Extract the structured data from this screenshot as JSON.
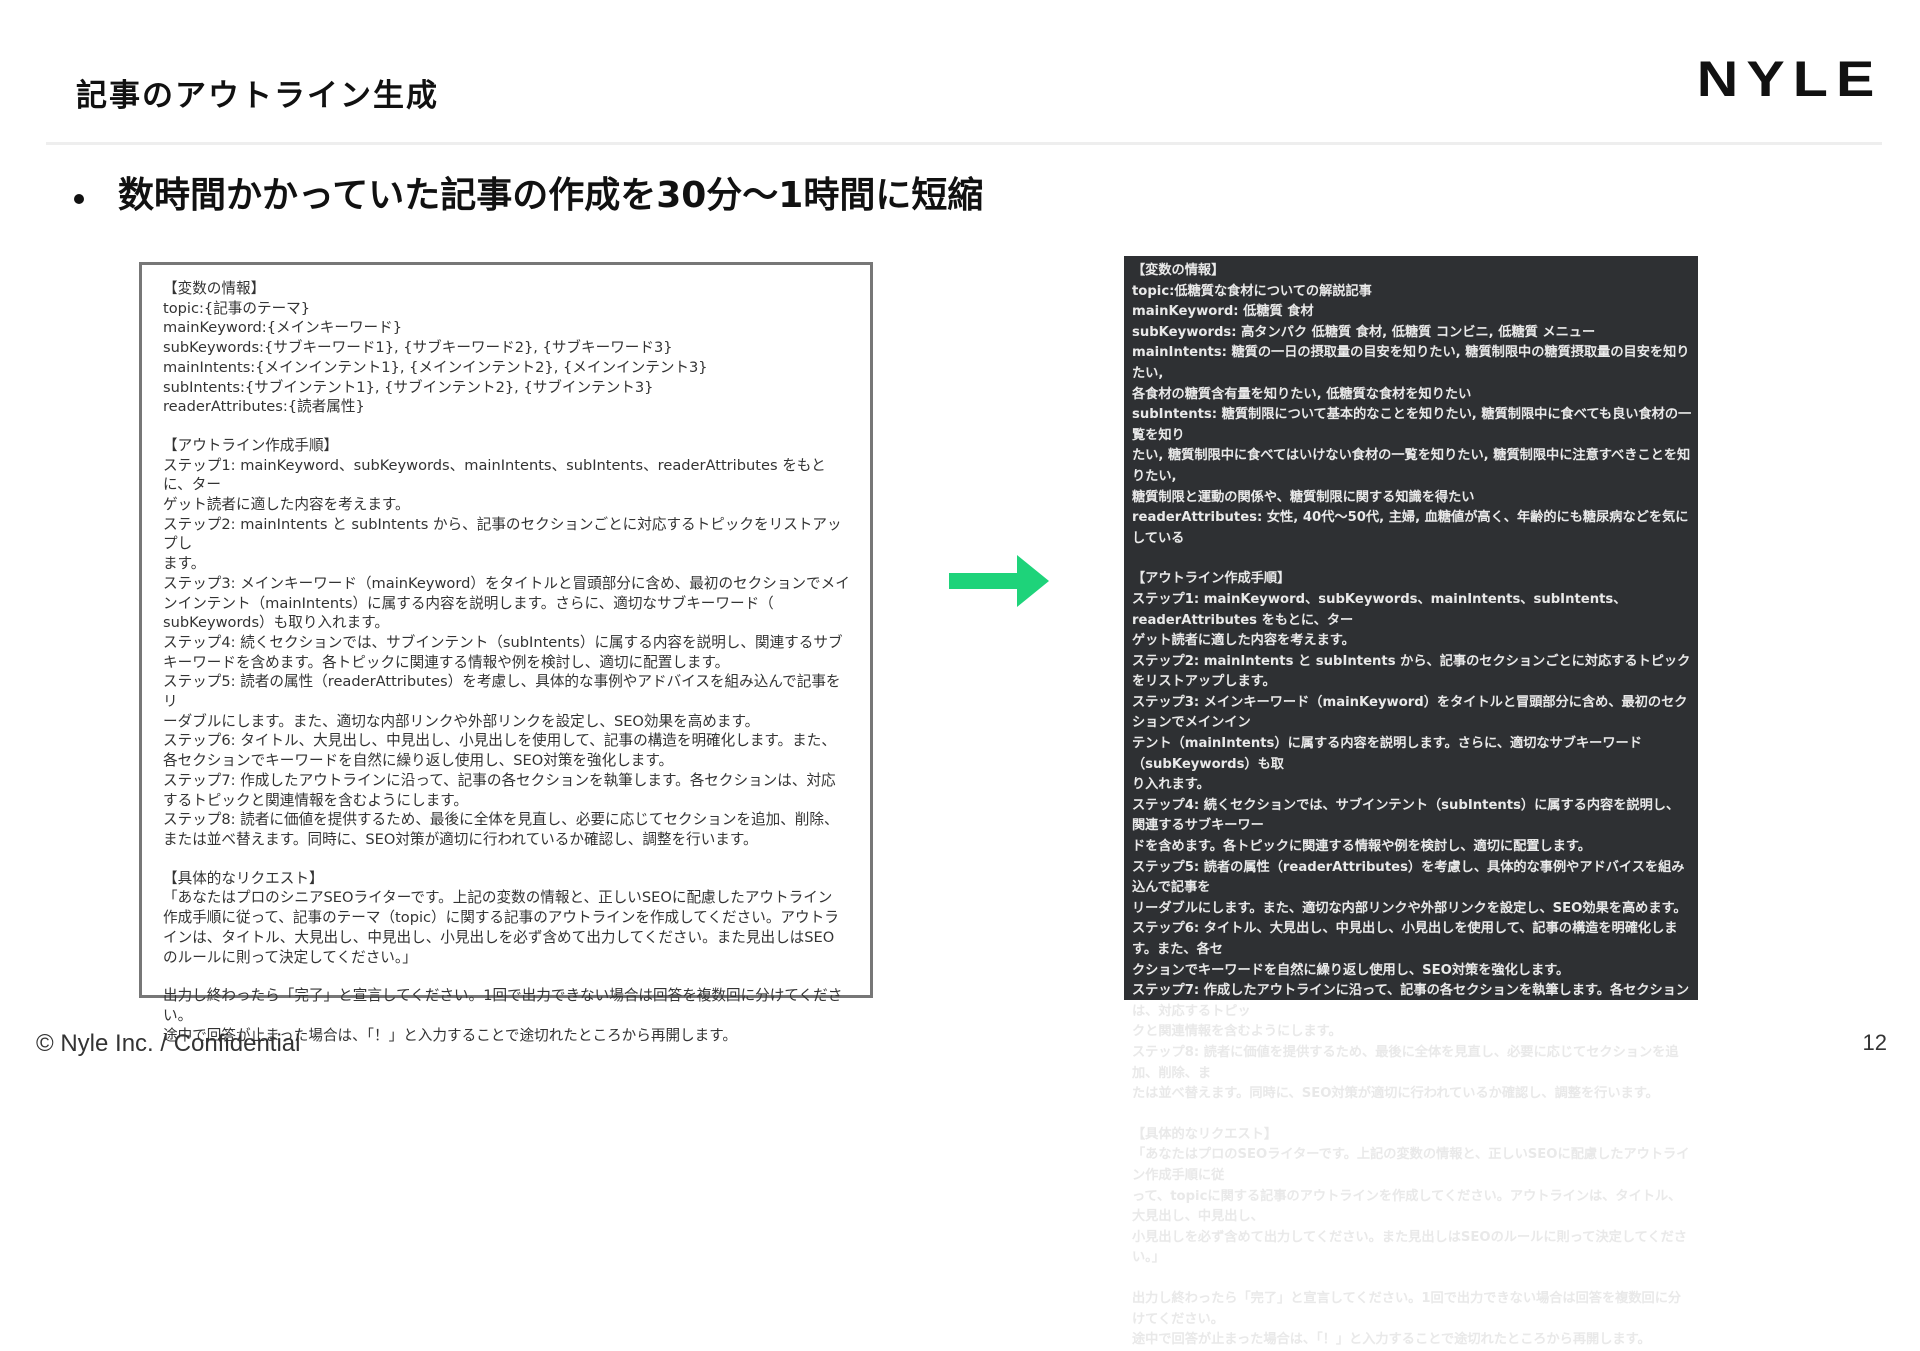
{
  "slide": {
    "title": "記事のアウトライン生成",
    "logo": "NYLE",
    "bullet": "数時間かかっていた記事の作成を30分〜1時間に短縮"
  },
  "template_prompt": {
    "variables": "【変数の情報】\ntopic:{記事のテーマ}\nmainKeyword:{メインキーワード}\nsubKeywords:{サブキーワード1}, {サブキーワード2}, {サブキーワード3}\nmainIntents:{メインインテント1}, {メインインテント2}, {メインインテント3}\nsubIntents:{サブインテント1}, {サブインテント2}, {サブインテント3}\nreaderAttributes:{読者属性}",
    "steps": "【アウトライン作成手順】\nステップ1: mainKeyword、subKeywords、mainIntents、subIntents、readerAttributes をもとに、ター\nゲット読者に適した内容を考えます。\nステップ2: mainIntents と subIntents から、記事のセクションごとに対応するトピックをリストアップし\nます。\nステップ3: メインキーワード（mainKeyword）をタイトルと冒頭部分に含め、最初のセクションでメイ\nンインテント（mainIntents）に属する内容を説明します。さらに、適切なサブキーワード（\nsubKeywords）も取り入れます。\nステップ4: 続くセクションでは、サブインテント（subIntents）に属する内容を説明し、関連するサブ\nキーワードを含めます。各トピックに関連する情報や例を検討し、適切に配置します。\nステップ5: 読者の属性（readerAttributes）を考慮し、具体的な事例やアドバイスを組み込んで記事をリ\nーダブルにします。また、適切な内部リンクや外部リンクを設定し、SEO効果を高めます。\nステップ6: タイトル、大見出し、中見出し、小見出しを使用して、記事の構造を明確化します。また、\n各セクションでキーワードを自然に繰り返し使用し、SEO対策を強化します。\nステップ7: 作成したアウトラインに沿って、記事の各セクションを執筆します。各セクションは、対応\nするトピックと関連情報を含むようにします。\nステップ8: 読者に価値を提供するため、最後に全体を見直し、必要に応じてセクションを追加、削除、\nまたは並べ替えます。同時に、SEO対策が適切に行われているか確認し、調整を行います。",
    "request": "【具体的なリクエスト】\n「あなたはプロのシニアSEOライターです。上記の変数の情報と、正しいSEOに配慮したアウトライン\n作成手順に従って、記事のテーマ（topic）に関する記事のアウトラインを作成してください。アウトラ\nインは、タイトル、大見出し、中見出し、小見出しを必ず含めて出力してください。また見出しはSEO\nのルールに則って決定してください。」",
    "closing": "出力し終わったら「完了」と宣言してください。1回で出力できない場合は回答を複数回に分けてくださ\nい。\n途中で回答が止まった場合は、「！」と入力することで途切れたところから再開します。"
  },
  "filled_prompt": {
    "variables": "【変数の情報】\ntopic:低糖質な食材についての解説記事\nmainKeyword: 低糖質 食材\nsubKeywords: 高タンパク 低糖質 食材, 低糖質 コンビニ, 低糖質 メニュー\nmainIntents: 糖質の一日の摂取量の目安を知りたい, 糖質制限中の糖質摂取量の目安を知りたい,\n各食材の糖質含有量を知りたい, 低糖質な食材を知りたい\nsubIntents: 糖質制限について基本的なことを知りたい, 糖質制限中に食べても良い食材の一覧を知り\nたい, 糖質制限中に食べてはいけない食材の一覧を知りたい, 糖質制限中に注意すべきことを知りたい,\n糖質制限と運動の関係や、糖質制限に関する知識を得たい\nreaderAttributes: 女性, 40代〜50代, 主婦, 血糖値が高く、年齢的にも糖尿病などを気にしている",
    "steps": "【アウトライン作成手順】\nステップ1: mainKeyword、subKeywords、mainIntents、subIntents、readerAttributes をもとに、ター\nゲット読者に適した内容を考えます。\nステップ2: mainIntents と subIntents から、記事のセクションごとに対応するトピックをリストアップします。\nステップ3: メインキーワード（mainKeyword）をタイトルと冒頭部分に含め、最初のセクションでメインイン\nテント（mainIntents）に属する内容を説明します。さらに、適切なサブキーワード（subKeywords）も取\nり入れます。\nステップ4: 続くセクションでは、サブインテント（subIntents）に属する内容を説明し、関連するサブキーワー\nドを含めます。各トピックに関連する情報や例を検討し、適切に配置します。\nステップ5: 読者の属性（readerAttributes）を考慮し、具体的な事例やアドバイスを組み込んで記事を\nリーダブルにします。また、適切な内部リンクや外部リンクを設定し、SEO効果を高めます。\nステップ6: タイトル、大見出し、中見出し、小見出しを使用して、記事の構造を明確化します。また、各セ\nクションでキーワードを自然に繰り返し使用し、SEO対策を強化します。\nステップ7: 作成したアウトラインに沿って、記事の各セクションを執筆します。各セクションは、対応するトピッ\nクと関連情報を含むようにします。\nステップ8: 読者に価値を提供するため、最後に全体を見直し、必要に応じてセクションを追加、削除、ま\nたは並べ替えます。同時に、SEO対策が適切に行われているか確認し、調整を行います。",
    "request": "【具体的なリクエスト】\n「あなたはプロのSEOライターです。上記の変数の情報と、正しいSEOに配慮したアウトライン作成手順に従\nって、topicに関する記事のアウトラインを作成してください。アウトラインは、タイトル、大見出し、中見出し、\n小見出しを必ず含めて出力してください。また見出しはSEOのルールに則って決定してください。」",
    "closing": "出力し終わったら「完了」と宣言してください。1回で出力できない場合は回答を複数回に分けてください。\n途中で回答が止まった場合は、「！」と入力することで途切れたところから再開します。"
  },
  "colors": {
    "arrow": "#1ed37a",
    "dark_panel": "#2e3033"
  },
  "icons": {
    "arrow": "right-arrow-icon",
    "bullet": "bullet-dot"
  },
  "footer": {
    "copyright": "© Nyle Inc. / Confidential",
    "page_number": "12"
  }
}
